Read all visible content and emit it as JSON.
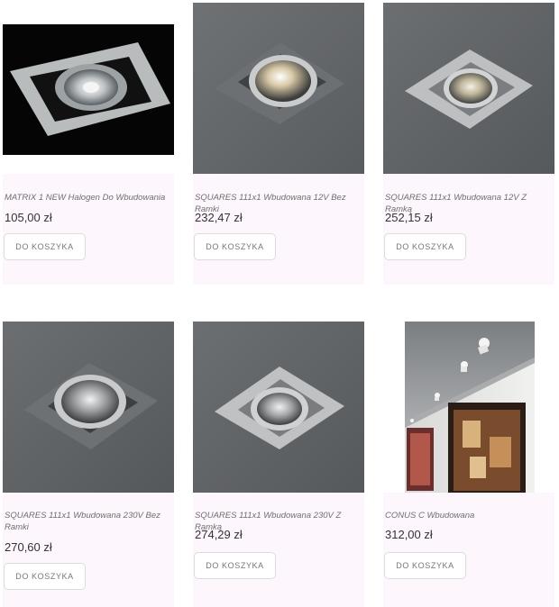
{
  "products": [
    {
      "title": "MATRIX 1 NEW Halogen Do Wbudowania",
      "price": "105,00 zł",
      "button": "DO KOSZYKA"
    },
    {
      "title": "SQUARES 111x1 Wbudowana 12V Bez Ramki",
      "price": "232,47 zł",
      "button": "DO KOSZYKA"
    },
    {
      "title": "SQUARES 111x1 Wbudowana 12V Z Ramką",
      "price": "252,15 zł",
      "button": "DO KOSZYKA"
    },
    {
      "title": "SQUARES 111x1 Wbudowana 230V Bez Ramki",
      "price": "270,60 zł",
      "button": "DO KOSZYKA"
    },
    {
      "title": "SQUARES 111x1 Wbudowana 230V Z Ramką",
      "price": "274,29 zł",
      "button": "DO KOSZYKA"
    },
    {
      "title": "CONUS C Wbudowana",
      "price": "312,00 zł",
      "button": "DO KOSZYKA"
    }
  ],
  "colors": {
    "info_background": "#fdf6fc",
    "price_text": "#333333",
    "title_text": "#6f6f6f"
  }
}
